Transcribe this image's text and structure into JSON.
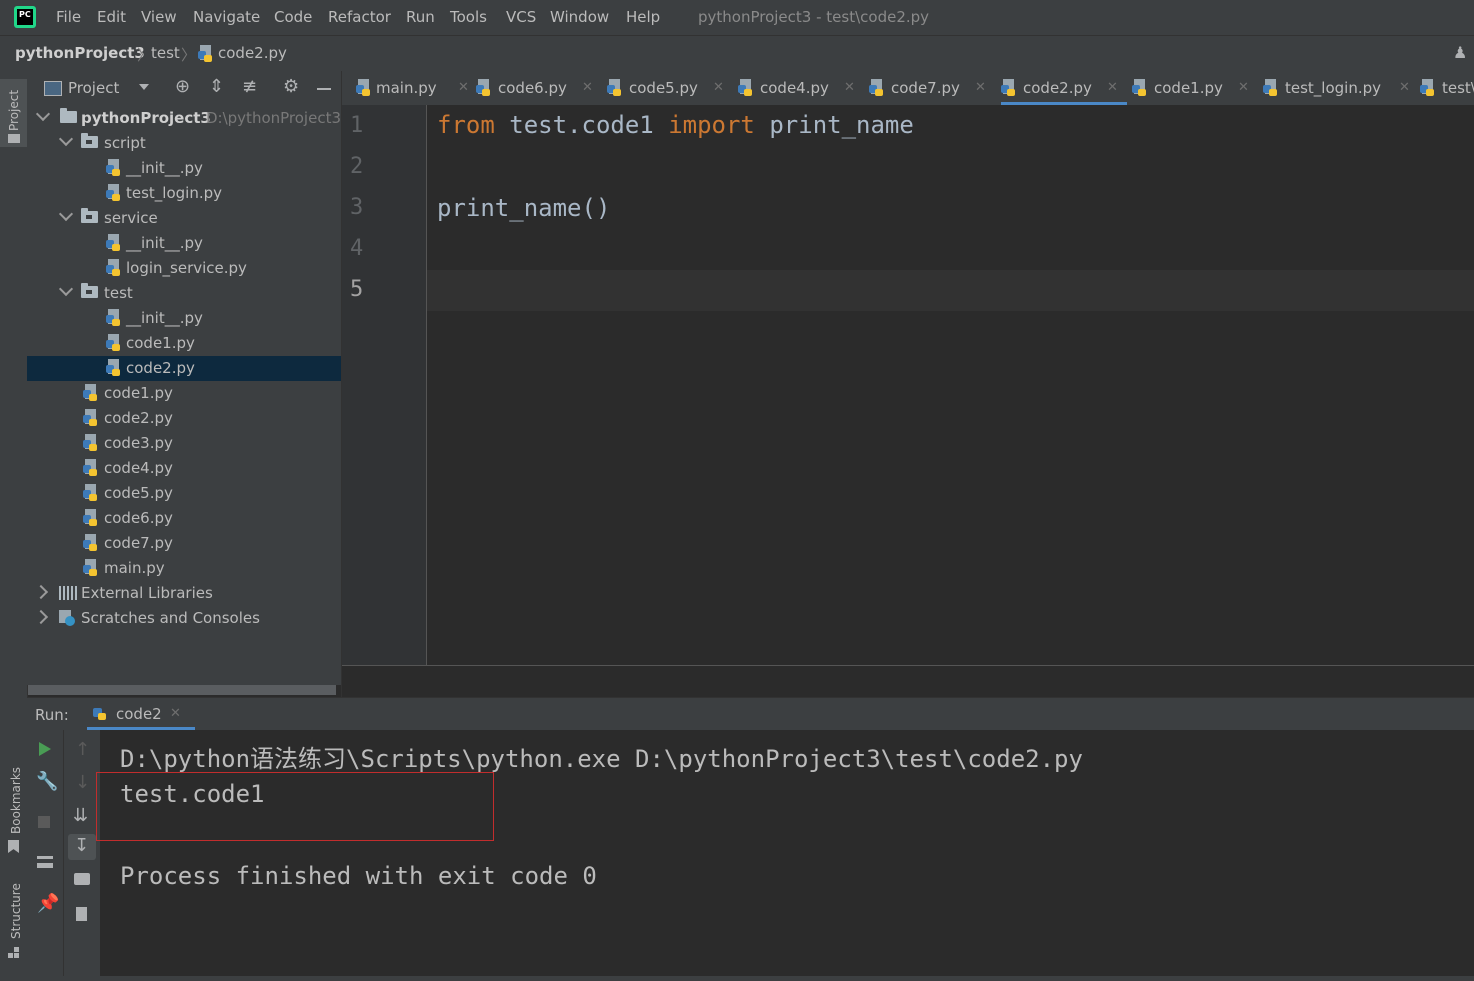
{
  "menubar": {
    "items": [
      "File",
      "Edit",
      "View",
      "Navigate",
      "Code",
      "Refactor",
      "Run",
      "Tools",
      "VCS",
      "Window",
      "Help"
    ],
    "title": "pythonProject3 - test\\code2.py"
  },
  "navbar": {
    "crumbs": [
      "pythonProject3",
      "test",
      "code2.py"
    ]
  },
  "side": {
    "project": "Project",
    "bookmarks": "Bookmarks",
    "structure": "Structure"
  },
  "project_panel": {
    "title": "Project",
    "tree": [
      {
        "label": "pythonProject3",
        "hint": "D:\\pythonProject3"
      },
      {
        "label": "script"
      },
      {
        "label": "__init__.py"
      },
      {
        "label": "test_login.py"
      },
      {
        "label": "service"
      },
      {
        "label": "__init__.py"
      },
      {
        "label": "login_service.py"
      },
      {
        "label": "test"
      },
      {
        "label": "__init__.py"
      },
      {
        "label": "code1.py"
      },
      {
        "label": "code2.py"
      },
      {
        "label": "code1.py"
      },
      {
        "label": "code2.py"
      },
      {
        "label": "code3.py"
      },
      {
        "label": "code4.py"
      },
      {
        "label": "code5.py"
      },
      {
        "label": "code6.py"
      },
      {
        "label": "code7.py"
      },
      {
        "label": "main.py"
      },
      {
        "label": "External Libraries"
      },
      {
        "label": "Scratches and Consoles"
      }
    ]
  },
  "editor_tabs": [
    "main.py",
    "code6.py",
    "code5.py",
    "code4.py",
    "code7.py",
    "code2.py",
    "code1.py",
    "test_login.py",
    "test\\"
  ],
  "editor": {
    "line_numbers": [
      "1",
      "2",
      "3",
      "4",
      "5"
    ],
    "line1": {
      "kw1": "from",
      "mod": " test.code1 ",
      "kw2": "import",
      "name": " print_name"
    },
    "line3": "print_name()"
  },
  "run": {
    "label": "Run:",
    "tab": "code2",
    "output": [
      "D:\\python语法练习\\Scripts\\python.exe D:\\pythonProject3\\test\\code2.py",
      "test.code1",
      "Process finished with exit code 0"
    ]
  },
  "colors": {
    "keyword": "#cc7832",
    "code": "#a9b7c6",
    "selection": "#0d293e",
    "highlight_box": "#c22d2d"
  }
}
